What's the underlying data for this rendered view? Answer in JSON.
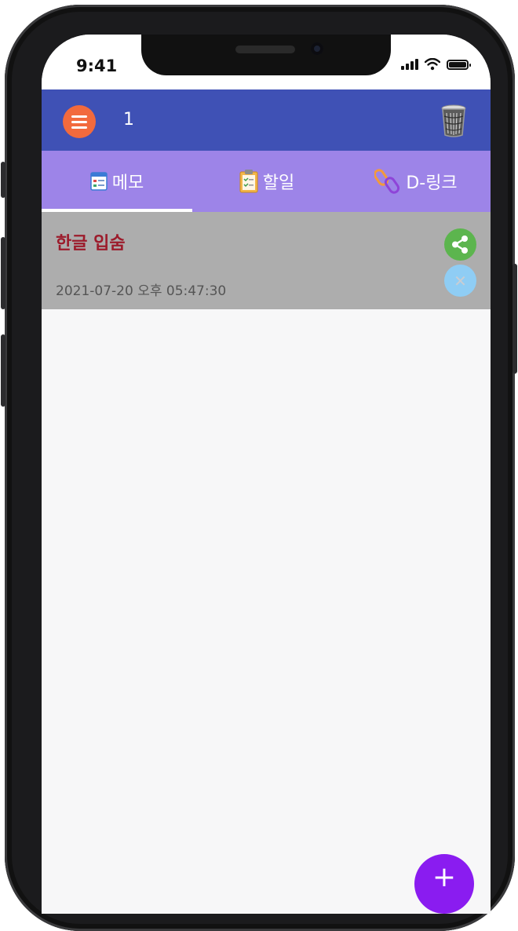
{
  "status_bar": {
    "time": "9:41"
  },
  "app_bar": {
    "count": "1"
  },
  "tabs": [
    {
      "label": "메모",
      "icon": "memo-icon"
    },
    {
      "label": "할일",
      "icon": "clipboard-icon"
    },
    {
      "label": "D-링크",
      "icon": "link-icon"
    }
  ],
  "memos": [
    {
      "title": "한글 입숨",
      "date": "2021-07-20 오후 05:47:30"
    }
  ],
  "fab": {
    "label": "+"
  },
  "colors": {
    "app_bar": "#3f51b5",
    "tab_bar": "#9d84e8",
    "menu_button": "#f26a3d",
    "memo_row": "#adadad",
    "memo_title": "#9c1b2b",
    "share_button": "#5cb54e",
    "delete_button": "#8fcdf4",
    "fab": "#8a1cf0"
  }
}
